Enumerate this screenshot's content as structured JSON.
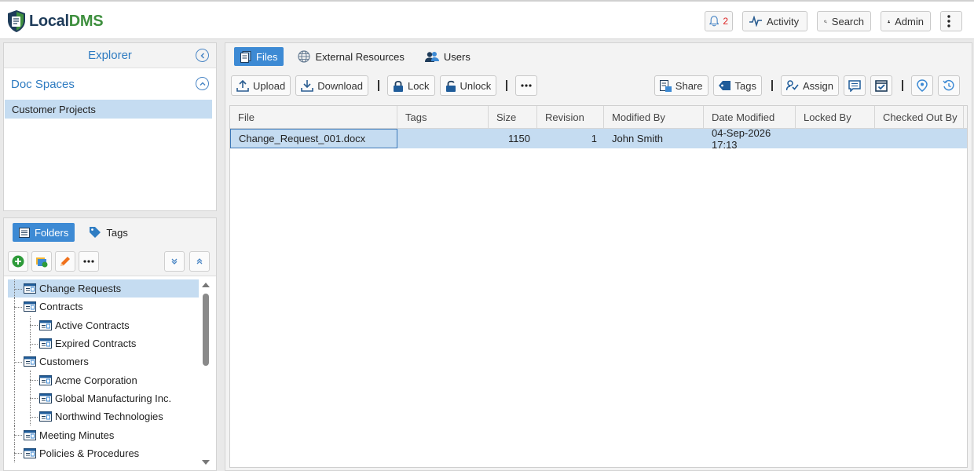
{
  "app": {
    "logo_part1": "Local",
    "logo_part2": "DMS",
    "brand_colors": {
      "primary": "#1f3c5a",
      "accent": "#3e8f3e",
      "selection": "#c5dcf1",
      "active_tab": "#3d8ad4"
    }
  },
  "header": {
    "notifications_count": "2",
    "activity_label": "Activity",
    "search_label": "Search",
    "user_label": "Admin"
  },
  "explorer": {
    "title": "Explorer",
    "docspaces_title": "Doc Spaces",
    "docspaces": [
      "Customer Projects"
    ]
  },
  "folders_panel": {
    "tabs": [
      {
        "label": "Folders",
        "icon": "folders-icon"
      },
      {
        "label": "Tags",
        "icon": "tag-icon"
      }
    ],
    "tree": [
      {
        "label": "Change Requests",
        "level": 0,
        "selected": true
      },
      {
        "label": "Contracts",
        "level": 0
      },
      {
        "label": "Active Contracts",
        "level": 1
      },
      {
        "label": "Expired Contracts",
        "level": 1
      },
      {
        "label": "Customers",
        "level": 0
      },
      {
        "label": "Acme Corporation",
        "level": 1
      },
      {
        "label": "Global Manufacturing Inc.",
        "level": 1
      },
      {
        "label": "Northwind Technologies",
        "level": 1
      },
      {
        "label": "Meeting Minutes",
        "level": 0
      },
      {
        "label": "Policies & Procedures",
        "level": 0
      }
    ]
  },
  "main": {
    "tabs": [
      {
        "label": "Files",
        "icon": "files-icon"
      },
      {
        "label": "External Resources",
        "icon": "globe-icon"
      },
      {
        "label": "Users",
        "icon": "users-icon"
      }
    ],
    "actions": {
      "upload": "Upload",
      "download": "Download",
      "lock": "Lock",
      "unlock": "Unlock",
      "share": "Share",
      "tags": "Tags",
      "assign": "Assign"
    },
    "table": {
      "columns": [
        "File",
        "Tags",
        "Size",
        "Revision",
        "Modified By",
        "Date Modified",
        "Locked By",
        "Checked Out By"
      ],
      "rows": [
        {
          "file": "Change_Request_001.docx",
          "tags": "",
          "size": "1150",
          "revision": "1",
          "modified_by": "John Smith",
          "date_modified": "04-Sep-2026 17:13",
          "locked_by": "",
          "checked_out_by": ""
        }
      ]
    }
  }
}
